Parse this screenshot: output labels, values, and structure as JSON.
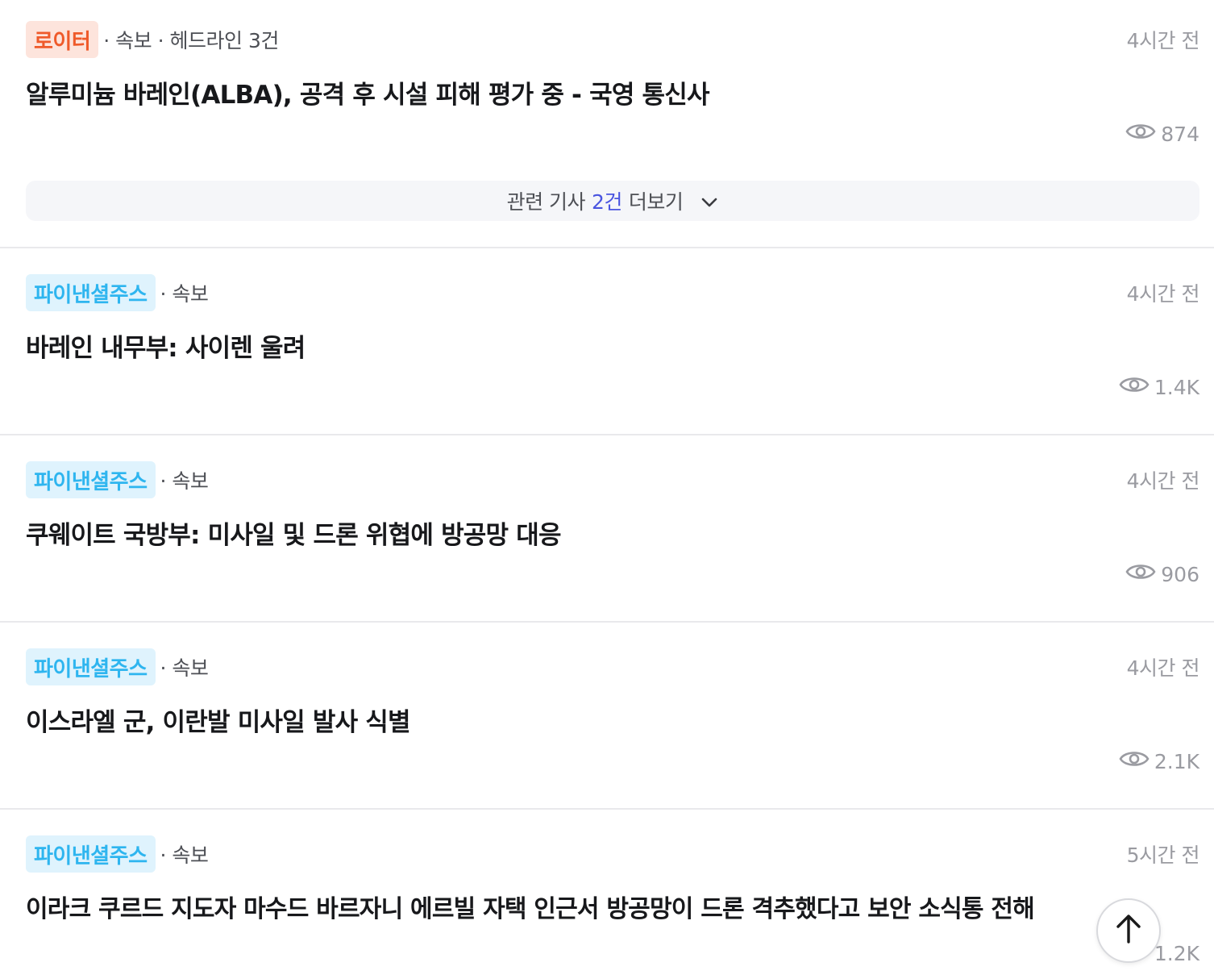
{
  "items": [
    {
      "source": "로이터",
      "source_style": "reuters",
      "meta": "· 속보 · 헤드라인 3건",
      "time": "4시간 전",
      "headline": "알루미늄 바레인(ALBA), 공격 후 시설 피해 평가 중 - 국영 통신사",
      "views": "874",
      "related": {
        "prefix": "관련 기사",
        "count": "2건",
        "suffix": "더보기"
      }
    },
    {
      "source": "파이낸셜주스",
      "source_style": "fj",
      "meta": "· 속보",
      "time": "4시간 전",
      "headline": "바레인 내무부: 사이렌 울려",
      "views": "1.4K"
    },
    {
      "source": "파이낸셜주스",
      "source_style": "fj",
      "meta": "· 속보",
      "time": "4시간 전",
      "headline": "쿠웨이트 국방부: 미사일 및 드론 위협에 방공망 대응",
      "views": "906"
    },
    {
      "source": "파이낸셜주스",
      "source_style": "fj",
      "meta": "· 속보",
      "time": "4시간 전",
      "headline": "이스라엘 군, 이란발 미사일 발사 식별",
      "views": "2.1K"
    },
    {
      "source": "파이낸셜주스",
      "source_style": "fj",
      "meta": "· 속보",
      "time": "5시간 전",
      "headline": "이라크 쿠르드 지도자 마수드 바르자니 에르빌 자택 인근서 방공망이 드론 격추했다고 보안 소식통 전해",
      "views": "1.2K"
    }
  ],
  "icons": {
    "views": "eye-icon",
    "expand": "chevron-down-icon",
    "scroll_top": "arrow-up-icon"
  },
  "colors": {
    "reuters_text": "#ef5a2a",
    "reuters_bg": "#fde4dc",
    "fj_text": "#2eb5ef",
    "fj_bg": "#dff3fd",
    "related_count": "#4a55e0"
  }
}
